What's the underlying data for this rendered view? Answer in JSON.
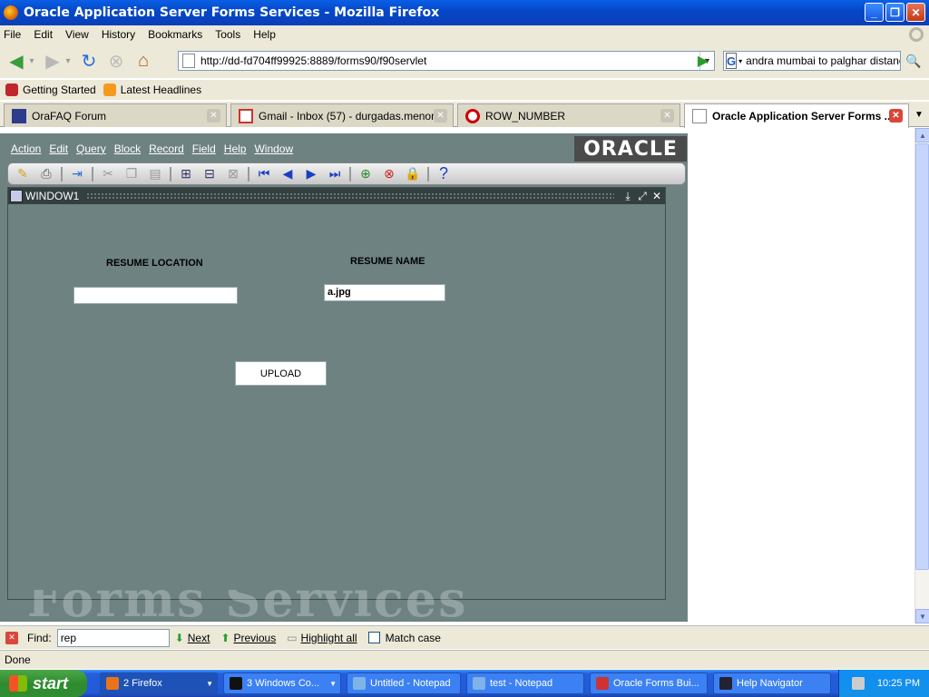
{
  "window": {
    "title": "Oracle Application Server Forms Services - Mozilla Firefox"
  },
  "menu": [
    "File",
    "Edit",
    "View",
    "History",
    "Bookmarks",
    "Tools",
    "Help"
  ],
  "nav": {
    "url": "http://dd-fd704ff99925:8889/forms90/f90servlet",
    "search_text": "andra mumbai to palghar distance"
  },
  "bookmarks": [
    "Getting Started",
    "Latest Headlines"
  ],
  "tabs": [
    "OraFAQ Forum",
    "Gmail - Inbox (57) - durgadas.menon...",
    "ROW_NUMBER",
    "Oracle Application Server Forms ..."
  ],
  "forms": {
    "menu": [
      "Action",
      "Edit",
      "Query",
      "Block",
      "Record",
      "Field",
      "Help",
      "Window"
    ],
    "logo": "ORACLE",
    "window_title": "WINDOW1",
    "resume_location_label": "RESUME LOCATION",
    "resume_name_label": "RESUME NAME",
    "resume_location_value": "",
    "resume_name_value": "a.jpg",
    "upload_label": "UPLOAD",
    "watermark": "Forms Services"
  },
  "findbar": {
    "label": "Find:",
    "value": "rep",
    "next": "Next",
    "previous": "Previous",
    "highlight": "Highlight all",
    "match_case": "Match case"
  },
  "status": "Done",
  "taskbar": {
    "start": "start",
    "tasks": [
      "2 Firefox",
      "3 Windows Co...",
      "Untitled - Notepad",
      "test - Notepad",
      "Oracle Forms Bui...",
      "Help Navigator"
    ],
    "clock": "10:25 PM"
  }
}
